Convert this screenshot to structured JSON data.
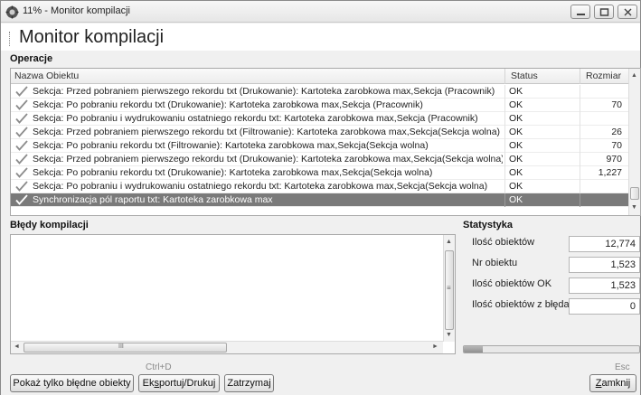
{
  "window": {
    "title": "11% - Monitor kompilacji"
  },
  "header": {
    "title": "Monitor kompilacji"
  },
  "operations": {
    "section_label": "Operacje",
    "columns": {
      "name": "Nazwa Obiektu",
      "status": "Status",
      "size": "Rozmiar"
    },
    "rows": [
      {
        "name": "Sekcja: Przed pobraniem pierwszego rekordu txt (Drukowanie): Kartoteka zarobkowa max,Sekcja (Pracownik)",
        "status": "OK",
        "size": ""
      },
      {
        "name": "Sekcja: Po pobraniu rekordu txt (Drukowanie): Kartoteka zarobkowa max,Sekcja (Pracownik)",
        "status": "OK",
        "size": "70"
      },
      {
        "name": "Sekcja: Po pobraniu i wydrukowaniu ostatniego rekordu txt: Kartoteka zarobkowa max,Sekcja (Pracownik)",
        "status": "OK",
        "size": ""
      },
      {
        "name": "Sekcja: Przed pobraniem pierwszego rekordu txt (Filtrowanie): Kartoteka zarobkowa max,Sekcja(Sekcja wolna)",
        "status": "OK",
        "size": "26"
      },
      {
        "name": "Sekcja: Po pobraniu rekordu txt (Filtrowanie): Kartoteka zarobkowa max,Sekcja(Sekcja wolna)",
        "status": "OK",
        "size": "70"
      },
      {
        "name": "Sekcja: Przed pobraniem pierwszego rekordu txt (Drukowanie): Kartoteka zarobkowa max,Sekcja(Sekcja wolna)",
        "status": "OK",
        "size": "970"
      },
      {
        "name": "Sekcja: Po pobraniu rekordu txt (Drukowanie): Kartoteka zarobkowa max,Sekcja(Sekcja wolna)",
        "status": "OK",
        "size": "1,227"
      },
      {
        "name": "Sekcja: Po pobraniu i wydrukowaniu ostatniego rekordu txt: Kartoteka zarobkowa max,Sekcja(Sekcja wolna)",
        "status": "OK",
        "size": ""
      },
      {
        "name": "Synchronizacja pól raportu txt: Kartoteka zarobkowa max",
        "status": "OK",
        "size": "",
        "selected": true
      }
    ]
  },
  "errors": {
    "section_label": "Błędy kompilacji",
    "scroll_arrow_up": "▲",
    "scroll_arrow_down": "▼",
    "scroll_arrow_left": "◄",
    "scroll_arrow_right": "►",
    "scroll_grip_h": "III",
    "scroll_grip_v": "≡"
  },
  "stats": {
    "section_label": "Statystyka",
    "items": [
      {
        "label": "Ilość obiektów",
        "value": "12,774"
      },
      {
        "label": "Nr obiektu",
        "value": "1,523"
      },
      {
        "label": "Ilość obiektów OK",
        "value": "1,523"
      },
      {
        "label": "Ilość obiektów z błędami",
        "value": "0"
      }
    ],
    "progress_fraction": 0.11
  },
  "footer": {
    "shortcut_ctrl": "Ctrl+D",
    "shortcut_esc": "Esc",
    "btn_show_errors": "Pokaż tylko błędne obiekty",
    "btn_export_prefix": "Ek",
    "btn_export_underlined": "s",
    "btn_export_suffix": "portuj/Drukuj",
    "btn_stop": "Zatrzymaj",
    "btn_close_underlined": "Z",
    "btn_close_suffix": "amknij"
  },
  "colors": {
    "selected_row": "#7a7a7a",
    "check_icon": "#8c8c8c"
  },
  "icons": {
    "app": "gear-globe-icon",
    "row_check": "checkmark-icon"
  }
}
